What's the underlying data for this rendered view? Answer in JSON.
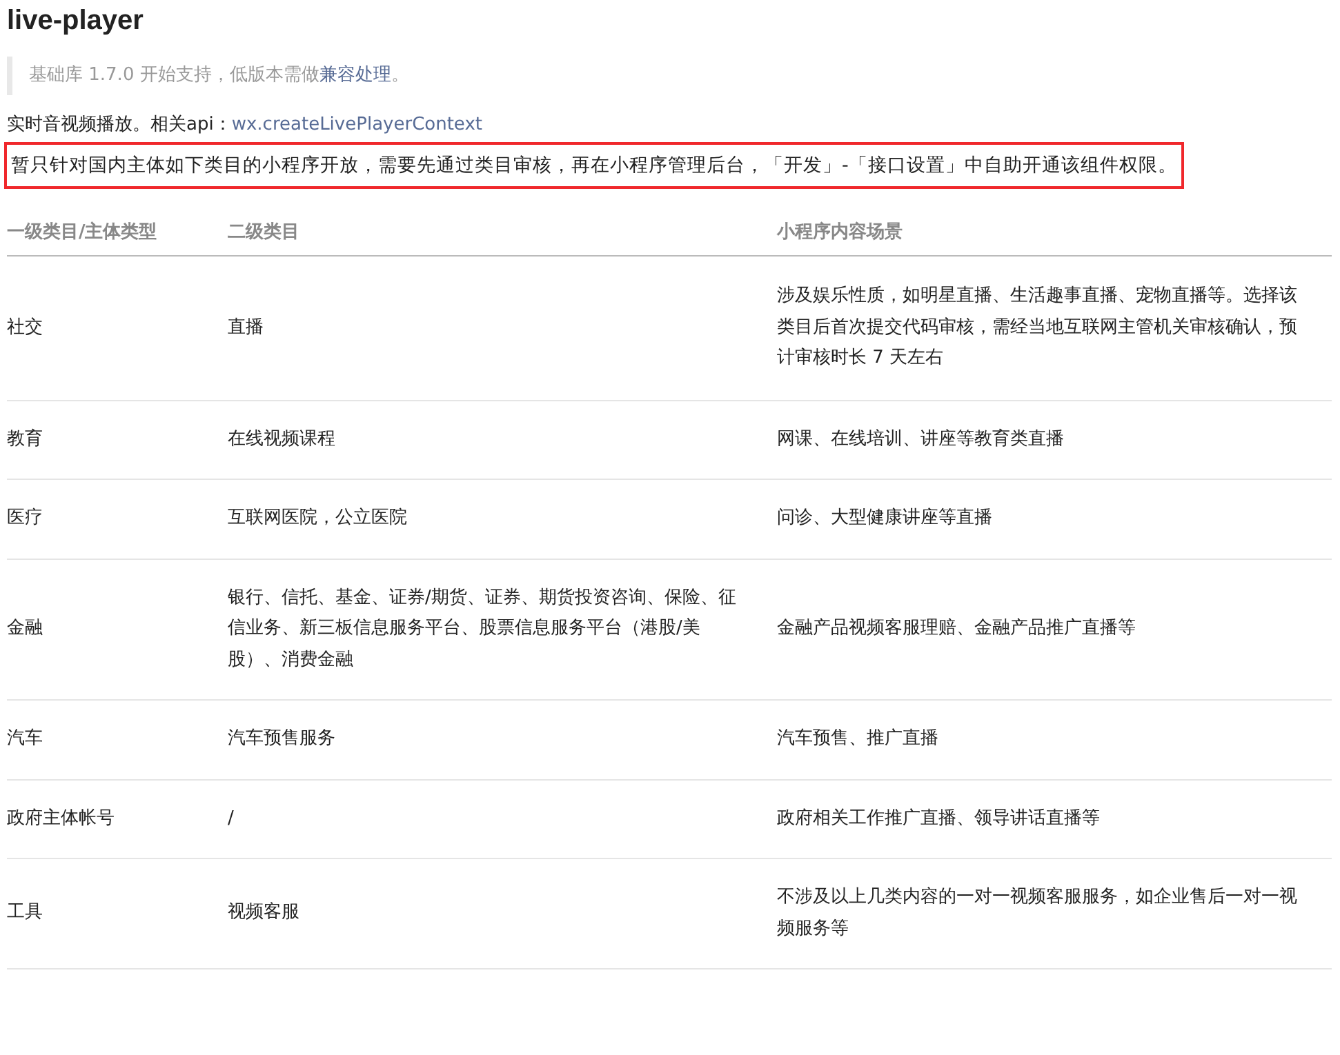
{
  "title": "live-player",
  "note": {
    "text": "基础库 1.7.0 开始支持，低版本需做",
    "link": "兼容处理",
    "suffix": "。"
  },
  "description": {
    "text": "实时音视频播放。相关api：",
    "link": "wx.createLivePlayerContext"
  },
  "notice": {
    "text": "暂只针对国内主体如下类目的小程序开放，需要先通过类目审核，再在小程序管理后台，「开发」-「接口设置」中自助开通该组件权限。",
    "highlighted": true
  },
  "table": {
    "columns": [
      "一级类目/主体类型",
      "二级类目",
      "小程序内容场景"
    ],
    "rows": [
      [
        "社交",
        "直播",
        "涉及娱乐性质，如明星直播、生活趣事直播、宠物直播等。选择该类目后首次提交代码审核，需经当地互联网主管机关审核确认，预计审核时长 7 天左右"
      ],
      [
        "教育",
        "在线视频课程",
        "网课、在线培训、讲座等教育类直播"
      ],
      [
        "医疗",
        "互联网医院，公立医院",
        "问诊、大型健康讲座等直播"
      ],
      [
        "金融",
        "银行、信托、基金、证券/期货、证券、期货投资咨询、保险、征信业务、新三板信息服务平台、股票信息服务平台（港股/美股）、消费金融",
        "金融产品视频客服理赔、金融产品推广直播等"
      ],
      [
        "汽车",
        "汽车预售服务",
        "汽车预售、推广直播"
      ],
      [
        "政府主体帐号",
        "/",
        "政府相关工作推广直播、领导讲话直播等"
      ],
      [
        "工具",
        "视频客服",
        "不涉及以上几类内容的一对一视频客服服务，如企业售后一对一视频服务等"
      ]
    ]
  }
}
